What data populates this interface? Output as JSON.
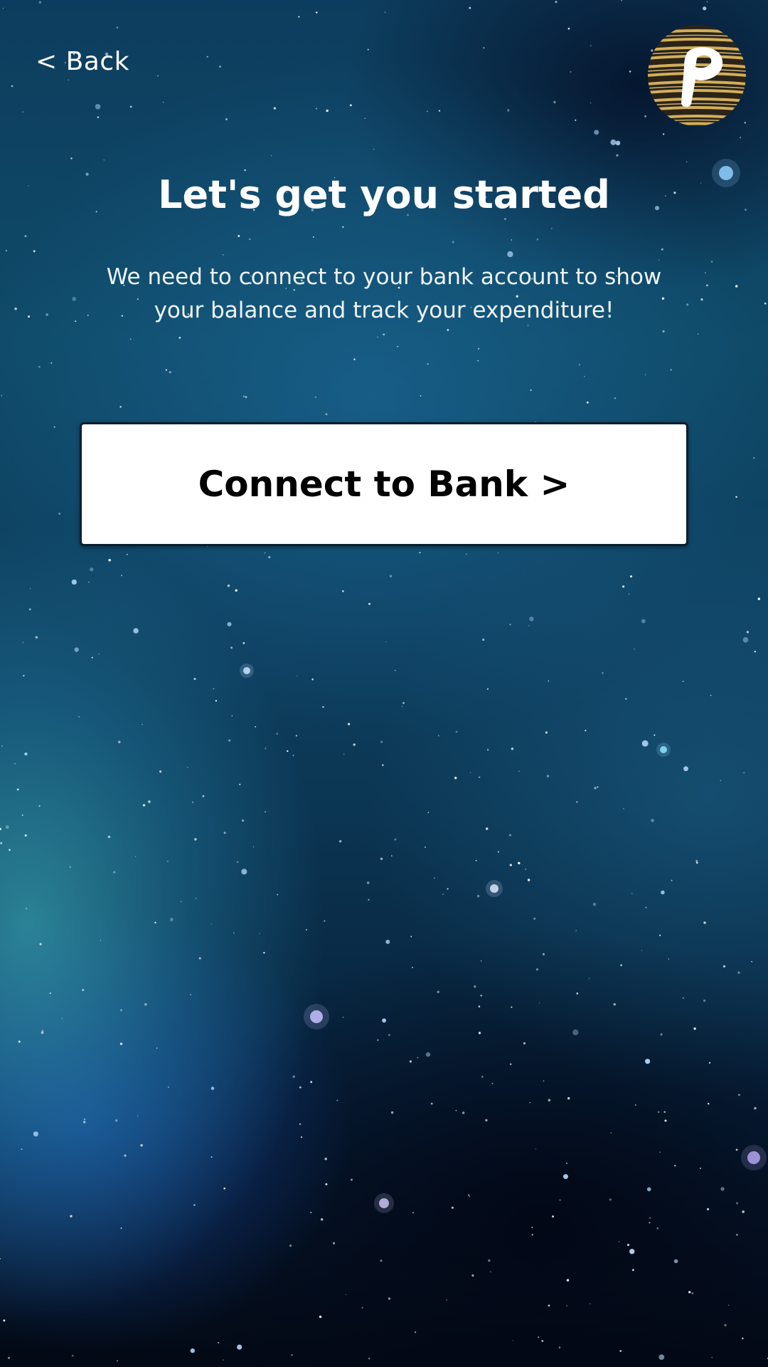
{
  "header": {
    "back_label": "< Back"
  },
  "logo": {
    "icon": "p-logo-icon",
    "colors": [
      "#c9a24a",
      "#ffffff"
    ]
  },
  "main": {
    "title": "Let's get you started",
    "subtitle": "We need to connect to your bank account to show your balance and track your expenditure!",
    "connect_button_label": "Connect to Bank >"
  },
  "theme": {
    "background": "space-nebula",
    "button_background": "#ffffff",
    "text_color": "#ffffff"
  }
}
